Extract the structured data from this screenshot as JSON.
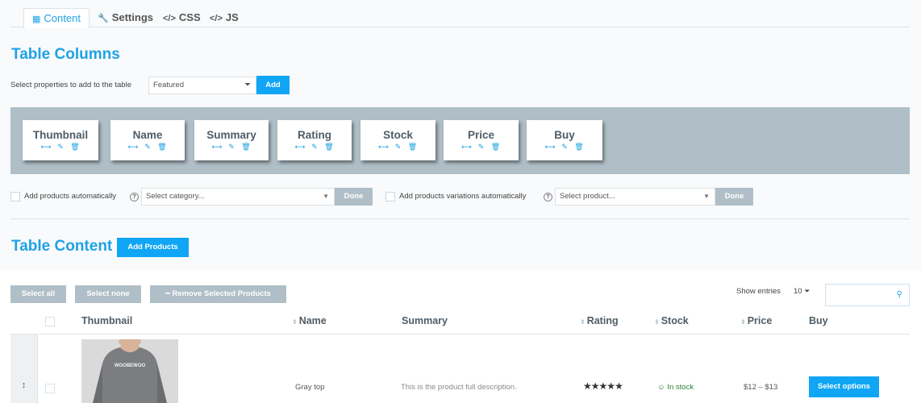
{
  "tabs": [
    {
      "label": "Content",
      "icon": "grid-icon"
    },
    {
      "label": "Settings",
      "icon": "wrench-icon"
    },
    {
      "label": "CSS",
      "icon": "code-icon"
    },
    {
      "label": "JS",
      "icon": "code-icon"
    }
  ],
  "columns_section": {
    "title": "Table Columns",
    "select_label": "Select properties to add to the table",
    "select_value": "Featured",
    "add_label": "Add",
    "columns": [
      "Thumbnail",
      "Name",
      "Summary",
      "Rating",
      "Stock",
      "Price",
      "Buy"
    ]
  },
  "auto": {
    "products_label": "Add products automatically",
    "category_placeholder": "Select category...",
    "done_label": "Done",
    "variations_label": "Add products variations automatically",
    "product_placeholder": "Select product..."
  },
  "content_section": {
    "title": "Table Content",
    "add_products_label": "Add Products"
  },
  "table_controls": {
    "select_all": "Select all",
    "select_none": "Select none",
    "remove_selected": "Remove Selected Products",
    "show_entries_label": "Show entries",
    "entries_value": "10"
  },
  "table": {
    "headers": {
      "thumbnail": "Thumbnail",
      "name": "Name",
      "summary": "Summary",
      "rating": "Rating",
      "stock": "Stock",
      "price": "Price",
      "buy": "Buy"
    },
    "rows": [
      {
        "thumb_text": "WOOBEWOO",
        "name": "Gray top",
        "summary": "This is the product full description.",
        "rating": 5,
        "stock": "In stock",
        "price": "$12 – $13",
        "buy_label": "Select options"
      }
    ]
  },
  "colors": {
    "accent": "#1fa2e4",
    "button_blue": "#10a5f5",
    "button_grey": "#b0bfc7",
    "stock_green": "#2e7d32"
  }
}
